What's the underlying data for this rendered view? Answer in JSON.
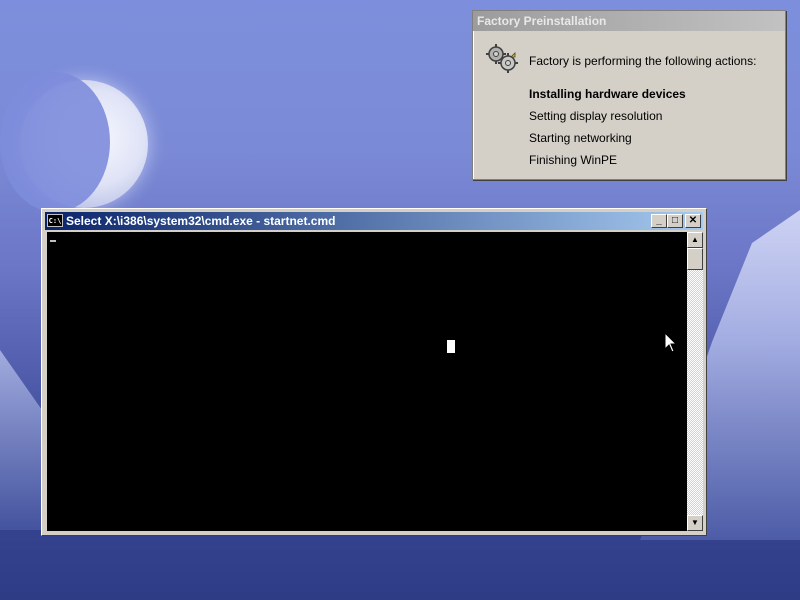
{
  "factory": {
    "title": "Factory Preinstallation",
    "intro": "Factory is performing the following actions:",
    "actions": [
      {
        "label": "Installing hardware devices",
        "active": true
      },
      {
        "label": "Setting display resolution",
        "active": false
      },
      {
        "label": "Starting networking",
        "active": false
      },
      {
        "label": "Finishing WinPE",
        "active": false
      }
    ]
  },
  "cmd": {
    "icon_text": "C:\\",
    "title": "Select X:\\i386\\system32\\cmd.exe - startnet.cmd",
    "minimize_glyph": "_",
    "maximize_glyph": "□",
    "close_glyph": "✕",
    "scroll_up_glyph": "▲",
    "scroll_down_glyph": "▼"
  },
  "icons": {
    "factory": "gears-icon",
    "cmd": "command-prompt-icon",
    "pointer": "mouse-pointer-icon"
  },
  "colors": {
    "titlebar_active_start": "#0a246a",
    "titlebar_active_end": "#a6caf0",
    "window_face": "#d4d0c8",
    "console_bg": "#000000"
  }
}
